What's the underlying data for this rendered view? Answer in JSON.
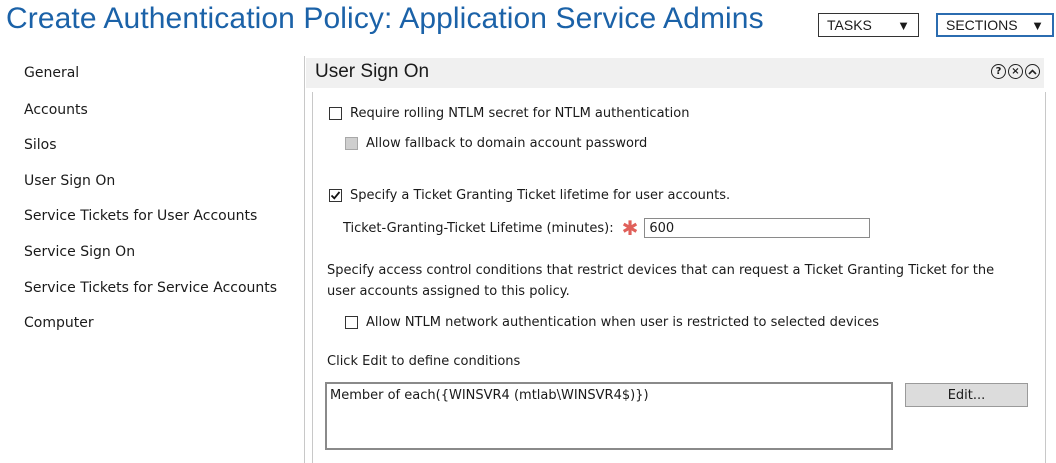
{
  "header": {
    "title": "Create Authentication Policy: Application Service Admins",
    "tasks_label": "TASKS",
    "sections_label": "SECTIONS"
  },
  "nav": {
    "items": [
      {
        "label": "General"
      },
      {
        "label": "Accounts"
      },
      {
        "label": "Silos"
      },
      {
        "label": "User Sign On"
      },
      {
        "label": "Service Tickets for User Accounts"
      },
      {
        "label": "Service Sign On"
      },
      {
        "label": "Service Tickets for Service Accounts"
      },
      {
        "label": "Computer"
      }
    ]
  },
  "panel": {
    "title": "User Sign On",
    "icons": {
      "help": "?",
      "close": "×",
      "collapse": "^"
    },
    "ntlm_secret_label": "Require rolling NTLM secret for NTLM authentication",
    "ntlm_secret_checked": false,
    "fallback_label": "Allow fallback to domain account password",
    "fallback_enabled": false,
    "tgt_label": "Specify a Ticket Granting Ticket lifetime for user accounts.",
    "tgt_checked": true,
    "tgt_lifetime_label": "Ticket-Granting-Ticket Lifetime (minutes):",
    "required_marker": "✱",
    "tgt_lifetime_value": "600",
    "access_control_text_line1": "Specify access control conditions that restrict devices that can request a Ticket Granting Ticket for the",
    "access_control_text_line2": "user accounts assigned to this policy.",
    "ntlm_network_label": "Allow NTLM network authentication when user is restricted to selected devices",
    "ntlm_network_checked": false,
    "edit_hint": "Click Edit to define conditions",
    "conditions_value": "Member of each({WINSVR4 (mtlab\\WINSVR4$)})",
    "edit_button_label": "Edit..."
  }
}
